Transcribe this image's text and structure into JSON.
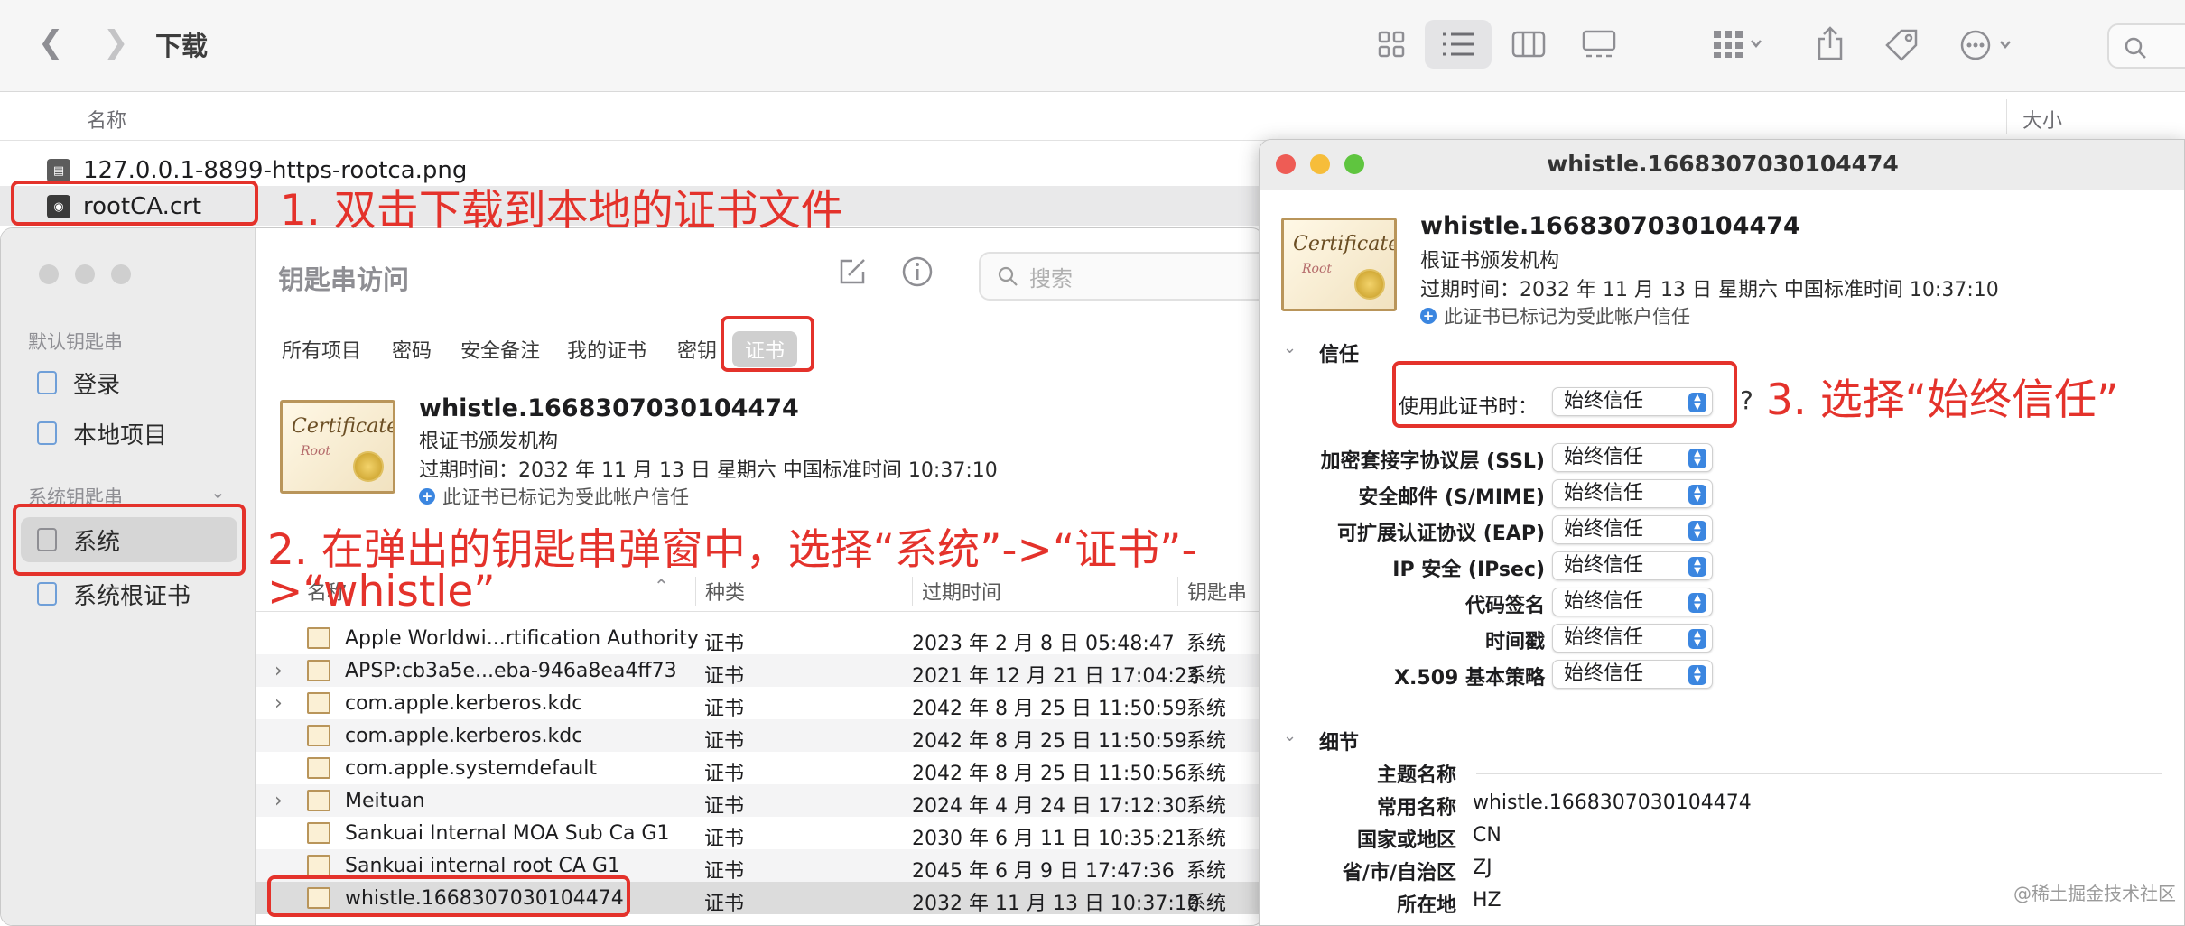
{
  "finder": {
    "title": "下载",
    "col_name": "名称",
    "col_size": "大小",
    "files": [
      {
        "name": "127.0.0.1-8899-https-rootca.png"
      },
      {
        "name": "rootCA.crt"
      }
    ]
  },
  "keychain": {
    "title": "钥匙串访问",
    "search_placeholder": "搜索",
    "sidebar": {
      "default_header": "默认钥匙串",
      "default_items": [
        "登录",
        "本地项目"
      ],
      "system_header": "系统钥匙串",
      "system_items": [
        "系统",
        "系统根证书"
      ]
    },
    "tabs": [
      "所有项目",
      "密码",
      "安全备注",
      "我的证书",
      "密钥",
      "证书"
    ],
    "cert": {
      "image_script": "Certificate",
      "image_sub": "Root",
      "name": "whistle.1668307030104474",
      "issuer": "根证书颁发机构",
      "expires": "过期时间：2032 年 11 月 13 日 星期六 中国标准时间 10:37:10",
      "trusted": "此证书已标记为受此帐户信任"
    },
    "columns": {
      "name": "名称",
      "kind": "种类",
      "expires": "过期时间",
      "keychain": "钥匙串"
    },
    "rows": [
      {
        "name": "Apple Worldwi...rtification Authority",
        "kind": "证书",
        "date": "2023 年 2 月 8 日 05:48:47",
        "keychain": "系统"
      },
      {
        "name": "APSP:cb3a5e...eba-946a8ea4ff73",
        "kind": "证书",
        "date": "2021 年 12 月 21 日 17:04:23",
        "keychain": "系统"
      },
      {
        "name": "com.apple.kerberos.kdc",
        "kind": "证书",
        "date": "2042 年 8 月 25 日 11:50:59",
        "keychain": "系统"
      },
      {
        "name": "com.apple.kerberos.kdc",
        "kind": "证书",
        "date": "2042 年 8 月 25 日 11:50:59",
        "keychain": "系统"
      },
      {
        "name": "com.apple.systemdefault",
        "kind": "证书",
        "date": "2042 年 8 月 25 日 11:50:56",
        "keychain": "系统"
      },
      {
        "name": "Meituan",
        "kind": "证书",
        "date": "2024 年 4 月 24 日 17:12:30",
        "keychain": "系统"
      },
      {
        "name": "Sankuai Internal MOA Sub Ca G1",
        "kind": "证书",
        "date": "2030 年 6 月 11 日 10:35:21",
        "keychain": "系统"
      },
      {
        "name": "Sankuai internal root CA G1",
        "kind": "证书",
        "date": "2045 年 6 月 9 日 17:47:36",
        "keychain": "系统"
      },
      {
        "name": "whistle.1668307030104474",
        "kind": "证书",
        "date": "2032 年 11 月 13 日 10:37:10",
        "keychain": "系统"
      }
    ]
  },
  "cert_window": {
    "title": "whistle.1668307030104474",
    "name": "whistle.1668307030104474",
    "issuer": "根证书颁发机构",
    "expires": "过期时间：2032 年 11 月 13 日 星期六 中国标准时间 10:37:10",
    "trusted": "此证书已标记为受此帐户信任",
    "trust_header": "信任",
    "when_using_label": "使用此证书时：",
    "when_using_value": "始终信任",
    "help": "?",
    "policies": [
      {
        "label": "加密套接字协议层 (SSL)",
        "value": "始终信任"
      },
      {
        "label": "安全邮件 (S/MIME)",
        "value": "始终信任"
      },
      {
        "label": "可扩展认证协议 (EAP)",
        "value": "始终信任"
      },
      {
        "label": "IP 安全 (IPsec)",
        "value": "始终信任"
      },
      {
        "label": "代码签名",
        "value": "始终信任"
      },
      {
        "label": "时间戳",
        "value": "始终信任"
      },
      {
        "label": "X.509 基本策略",
        "value": "始终信任"
      }
    ],
    "details_header": "细节",
    "details": [
      {
        "label": "主题名称",
        "value": ""
      },
      {
        "label": "常用名称",
        "value": "whistle.1668307030104474"
      },
      {
        "label": "国家或地区",
        "value": "CN"
      },
      {
        "label": "省/市/自治区",
        "value": "ZJ"
      },
      {
        "label": "所在地",
        "value": "HZ"
      }
    ]
  },
  "annotations": {
    "step1": "1. 双击下载到本地的证书文件",
    "step2_line1": "2. 在弹出的钥匙串弹窗中，选择“系统”->“证书”-",
    "step2_line2": ">“whistle”",
    "step3": "3. 选择“始终信任”"
  },
  "watermark": "@稀土掘金技术社区",
  "colors": {
    "annotation_red": "#e4322b",
    "accent_blue": "#3b86e0"
  }
}
